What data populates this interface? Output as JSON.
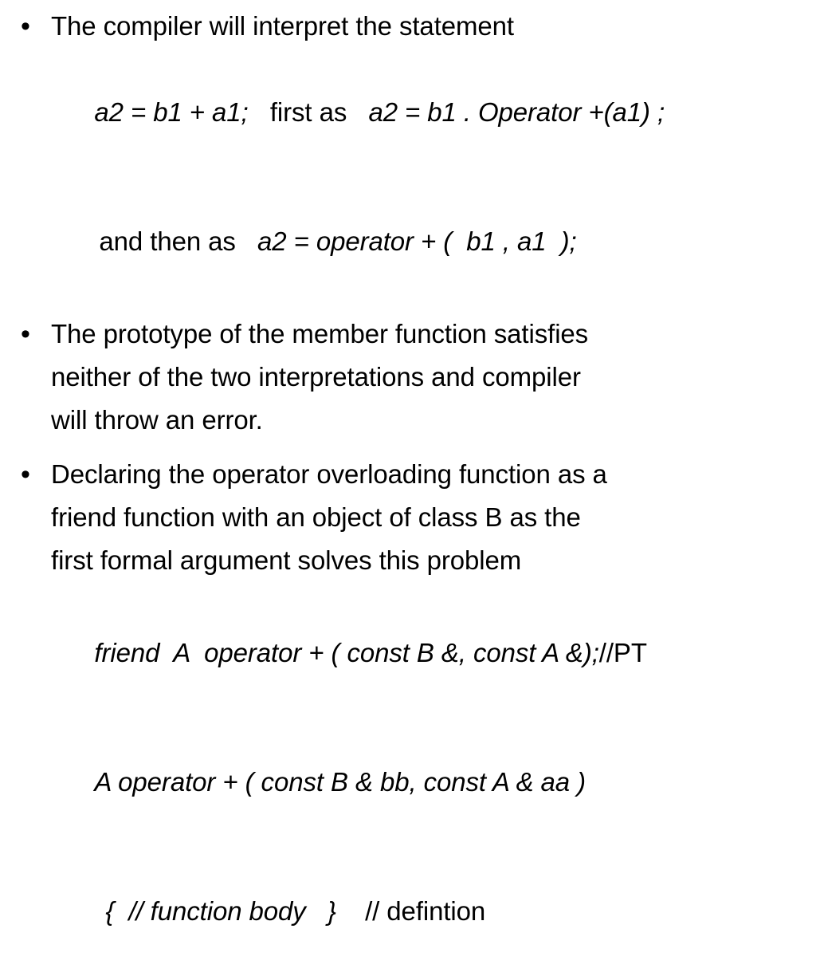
{
  "slide": {
    "background_color": "#ffffff",
    "text_color": "#000000",
    "bullet_glyph": "•"
  },
  "blocks": [
    {
      "type": "bullet",
      "bullet": "•",
      "line": "The compiler will interpret the statement"
    },
    {
      "type": "code_line",
      "indent": 1,
      "parts": [
        {
          "style": "italic",
          "text": "a2 = b1 + a1;"
        },
        {
          "style": "normal",
          "text": "   first as   "
        },
        {
          "style": "italic",
          "text": "a2 = b1 . Operator +(a1) ;"
        }
      ]
    },
    {
      "type": "code_line",
      "indent": 2,
      "parts": [
        {
          "style": "normal",
          "text": "and then as   "
        },
        {
          "style": "italic",
          "text": "a2 = operator + (  b1 , a1  );"
        }
      ]
    },
    {
      "type": "bullet",
      "bullet": "•",
      "line": "The prototype of the member function satisfies"
    },
    {
      "type": "text_line",
      "indent": 1,
      "text": "neither of the two interpretations and compiler"
    },
    {
      "type": "text_line",
      "indent": 1,
      "text": "will throw an error."
    },
    {
      "type": "bullet",
      "bullet": "•",
      "line": "Declaring the operator overloading function as a"
    },
    {
      "type": "text_line",
      "indent": 1,
      "text": "friend function with an object of class B as the"
    },
    {
      "type": "text_line",
      "indent": 1,
      "text": "first formal argument solves this problem"
    },
    {
      "type": "code_line",
      "indent": 1,
      "parts": [
        {
          "style": "italic",
          "text": "friend  A  operator + ( const B &, const A &);"
        },
        {
          "style": "normal",
          "text": "//PT"
        }
      ]
    },
    {
      "type": "code_line",
      "indent": 1,
      "parts": [
        {
          "style": "italic",
          "text": "A operator + ( const B & bb, const A & aa )"
        }
      ]
    },
    {
      "type": "code_line",
      "indent": 3,
      "parts": [
        {
          "style": "italic",
          "text": "{  // function body   }"
        },
        {
          "style": "normal",
          "text": "    // defintion"
        }
      ]
    }
  ]
}
